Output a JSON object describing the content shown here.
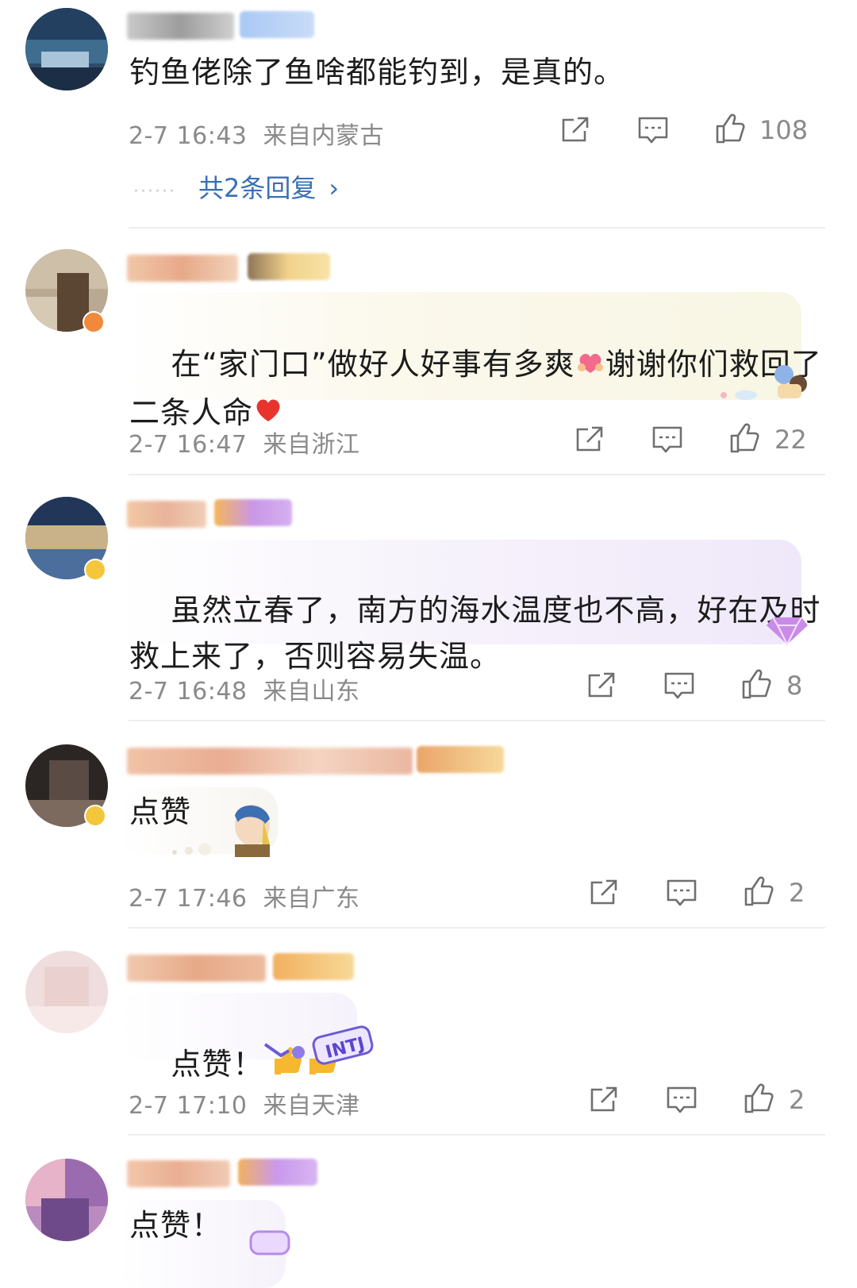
{
  "comments": [
    {
      "text": "钓鱼佬除了鱼啥都能钓到，是真的。",
      "time": "2-7 16:43",
      "location": "来自内蒙古",
      "likes": "108",
      "replies_label": "共2条回复",
      "replies_dots": "······"
    },
    {
      "text_a": "在“家门口”做好人好事有多爽",
      "text_b": "谢谢你们救回了",
      "text_c": "二条人命",
      "time": "2-7 16:47",
      "location": "来自浙江",
      "likes": "22"
    },
    {
      "text_a": "虽然立春了，南方的海水温度也不高，好在及时",
      "text_b": "救上来了，否则容易失温。",
      "time": "2-7 16:48",
      "location": "来自山东",
      "likes": "8"
    },
    {
      "text": "点赞",
      "time": "2-7 17:46",
      "location": "来自广东",
      "likes": "2"
    },
    {
      "text": "点赞！",
      "time": "2-7 17:10",
      "location": "来自天津",
      "likes": "2",
      "sticker_text": "INTJ"
    },
    {
      "text": "点赞！"
    }
  ],
  "icons": {
    "share": "share-icon",
    "comment": "comment-icon",
    "like": "thumbs-up-icon",
    "chevron": "chevron-right-icon"
  },
  "colors": {
    "link_blue": "#3a6fb6",
    "meta_gray": "#8a8a8a",
    "divider": "#eeeeee"
  }
}
